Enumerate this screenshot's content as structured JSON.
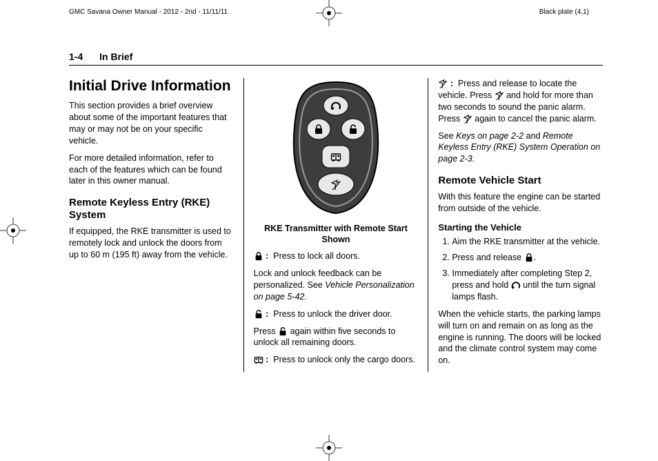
{
  "print": {
    "left": "GMC Savana Owner Manual - 2012 - 2nd - 11/11/11",
    "right": "Black plate (4,1)"
  },
  "header": {
    "page_number": "1-4",
    "section": "In Brief"
  },
  "col1": {
    "h1": "Initial Drive Information",
    "p1": "This section provides a brief overview about some of the important features that may or may not be on your specific vehicle.",
    "p2": "For more detailed information, refer to each of the features which can be found later in this owner manual.",
    "h2": "Remote Keyless Entry (RKE) System",
    "p3": "If equipped, the RKE transmitter is used to remotely lock and unlock the doors from up to 60 m (195 ft) away from the vehicle."
  },
  "col2": {
    "caption": "RKE Transmitter with Remote Start Shown",
    "lock_label": "Press to lock all doors.",
    "lock_p2a": "Lock and unlock feedback can be personalized. See ",
    "lock_p2_ref": "Vehicle Personalization on page 5-42.",
    "unlock_label": "Press to unlock the driver door.",
    "unlock_p1a": "Press ",
    "unlock_p1b": " again within five seconds to unlock all remaining doors.",
    "cargo_label": "Press to unlock only the cargo doors."
  },
  "col3": {
    "panic_a": "Press and release to locate the vehicle. Press ",
    "panic_b": " and hold for more than two seconds to sound the panic alarm. Press ",
    "panic_c": " again to cancel the panic alarm.",
    "see_a": "See ",
    "see_ref1": "Keys on page 2-2",
    "see_b": " and ",
    "see_ref2": "Remote Keyless Entry (RKE) System Operation on page 2-3.",
    "h2": "Remote Vehicle Start",
    "p1": "With this feature the engine can be started from outside of the vehicle.",
    "h3": "Starting the Vehicle",
    "step1": "Aim the RKE transmitter at the vehicle.",
    "step2a": "Press and release ",
    "step2b": ".",
    "step3a": "Immediately after completing Step 2, press and hold ",
    "step3b": " until the turn signal lamps flash.",
    "p_after": "When the vehicle starts, the parking lamps will turn on and remain on as long as the engine is running. The doors will be locked and the climate control system may come on."
  },
  "icons": {
    "lock": "lock-icon",
    "unlock": "unlock-icon",
    "cargo": "cargo-icon",
    "panic": "panic-icon",
    "remote_start": "remote-start-icon"
  }
}
